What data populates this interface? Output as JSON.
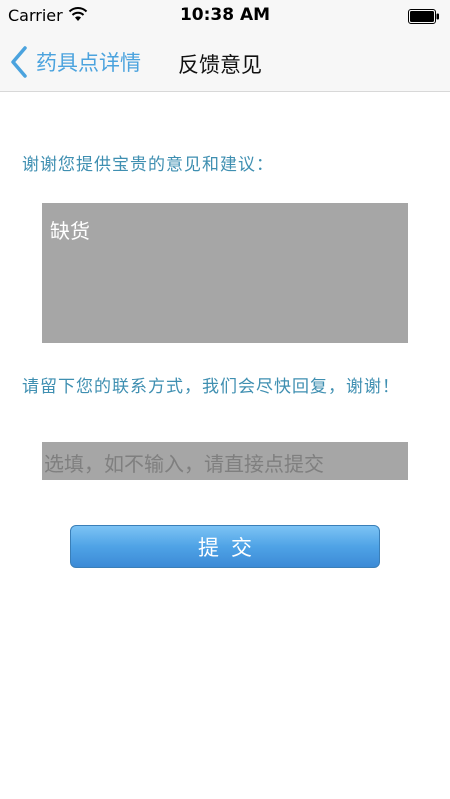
{
  "status_bar": {
    "carrier": "Carrier",
    "time": "10:38 AM",
    "icons": [
      "wifi-icon",
      "battery-icon"
    ]
  },
  "nav": {
    "back_label": "药具点详情",
    "back_icon": "chevron-left-icon",
    "title": "反馈意见",
    "accent_color": "#4ba3de"
  },
  "form": {
    "prompt_feedback": "谢谢您提供宝贵的意见和建议：",
    "feedback_value": "缺货",
    "prompt_contact": "请留下您的联系方式，我们会尽快回复，谢谢！",
    "contact_placeholder": "选填，如不输入，请直接点提交",
    "submit_label": "提交",
    "label_color": "#3f8fb1",
    "field_color": "#a6a6a6"
  }
}
